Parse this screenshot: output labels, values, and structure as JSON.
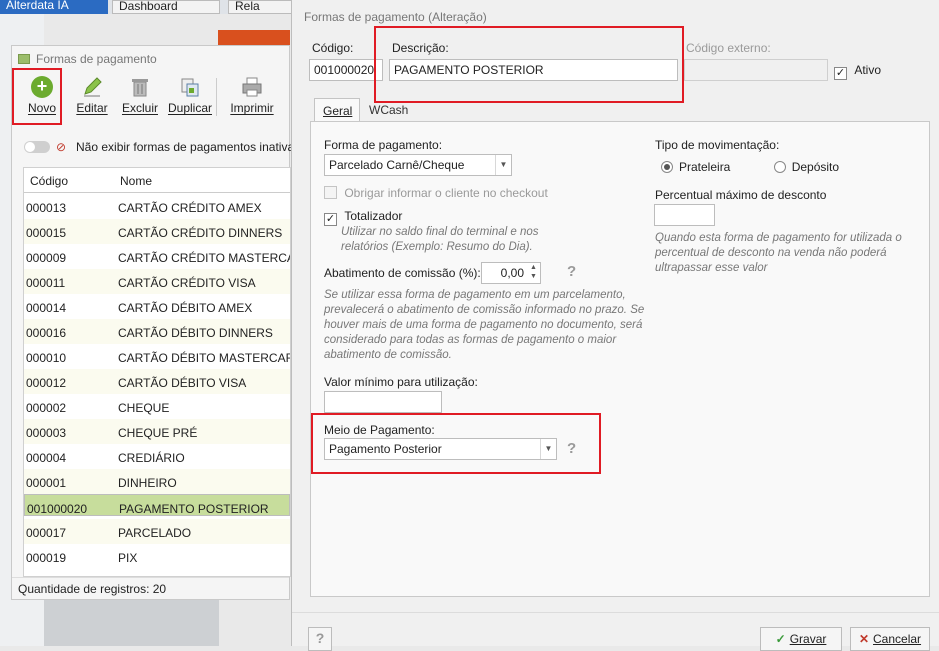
{
  "background": {
    "tabs": [
      "Alterdata IA",
      "Dashboard",
      "Rela"
    ]
  },
  "list_window": {
    "title": "Formas de pagamento",
    "toolbar": {
      "novo": "Novo",
      "editar": "Editar",
      "excluir": "Excluir",
      "duplicar": "Duplicar",
      "imprimir": "Imprimir"
    },
    "toggle_label": "Não exibir formas de pagamentos inativas",
    "columns": [
      "Código",
      "Nome"
    ],
    "rows": [
      {
        "codigo": "000013",
        "nome": "CARTÃO CRÉDITO AMEX"
      },
      {
        "codigo": "000015",
        "nome": "CARTÃO CRÉDITO DINNERS"
      },
      {
        "codigo": "000009",
        "nome": "CARTÃO CRÉDITO MASTERCARD"
      },
      {
        "codigo": "000011",
        "nome": "CARTÃO CRÉDITO VISA"
      },
      {
        "codigo": "000014",
        "nome": "CARTÃO DÉBITO AMEX"
      },
      {
        "codigo": "000016",
        "nome": "CARTÃO DÉBITO DINNERS"
      },
      {
        "codigo": "000010",
        "nome": "CARTÃO DÉBITO MASTERCARD"
      },
      {
        "codigo": "000012",
        "nome": "CARTÃO DÉBITO VISA"
      },
      {
        "codigo": "000002",
        "nome": "CHEQUE"
      },
      {
        "codigo": "000003",
        "nome": "CHEQUE PRÉ"
      },
      {
        "codigo": "000004",
        "nome": "CREDIÁRIO"
      },
      {
        "codigo": "000001",
        "nome": "DINHEIRO"
      },
      {
        "codigo": "001000020",
        "nome": "PAGAMENTO POSTERIOR"
      },
      {
        "codigo": "000017",
        "nome": "PARCELADO"
      },
      {
        "codigo": "000019",
        "nome": "PIX"
      }
    ],
    "selected_row": 12,
    "footer": "Quantidade de registros:  20"
  },
  "dialog": {
    "title": "Formas de pagamento (Alteração)",
    "codigo_label": "Código:",
    "codigo_value": "001000020",
    "descricao_label": "Descrição:",
    "descricao_value": "PAGAMENTO POSTERIOR",
    "codigo_externo_label": "Código externo:",
    "ativo_label": "Ativo",
    "tabs": [
      "Geral",
      "WCash"
    ],
    "forma_label": "Forma de pagamento:",
    "forma_value": "Parcelado Carnê/Cheque",
    "obrigar_label": "Obrigar informar o cliente no checkout",
    "totalizador_label": "Totalizador",
    "totalizador_help": "Utilizar no saldo final do terminal e nos relatórios (Exemplo: Resumo do Dia).",
    "abatimento_label": "Abatimento de comissão (%):",
    "abatimento_value": "0,00",
    "abatimento_help": "Se utilizar essa forma de pagamento em um parcelamento, prevalecerá o abatimento de comissão informado no prazo. Se houver mais de uma forma de pagamento no documento, será considerado para todas as formas de pagamento o maior abatimento de comissão.",
    "valor_minimo_label": "Valor mínimo para utilização:",
    "meio_label": "Meio de Pagamento:",
    "meio_value": "Pagamento Posterior",
    "tipo_label": "Tipo de movimentação:",
    "radio_prateleira": "Prateleira",
    "radio_deposito": "Depósito",
    "percentual_label": "Percentual máximo de desconto",
    "percentual_help": "Quando esta forma de pagamento for utilizada o percentual de desconto na venda não poderá ultrapassar esse valor",
    "help_button": "?",
    "gravar": "Gravar",
    "cancelar": "Cancelar"
  },
  "colors": {
    "highlight_red": "#e01b24",
    "selected_row": "#c7dd9c",
    "accent_green": "#6cab2f"
  }
}
